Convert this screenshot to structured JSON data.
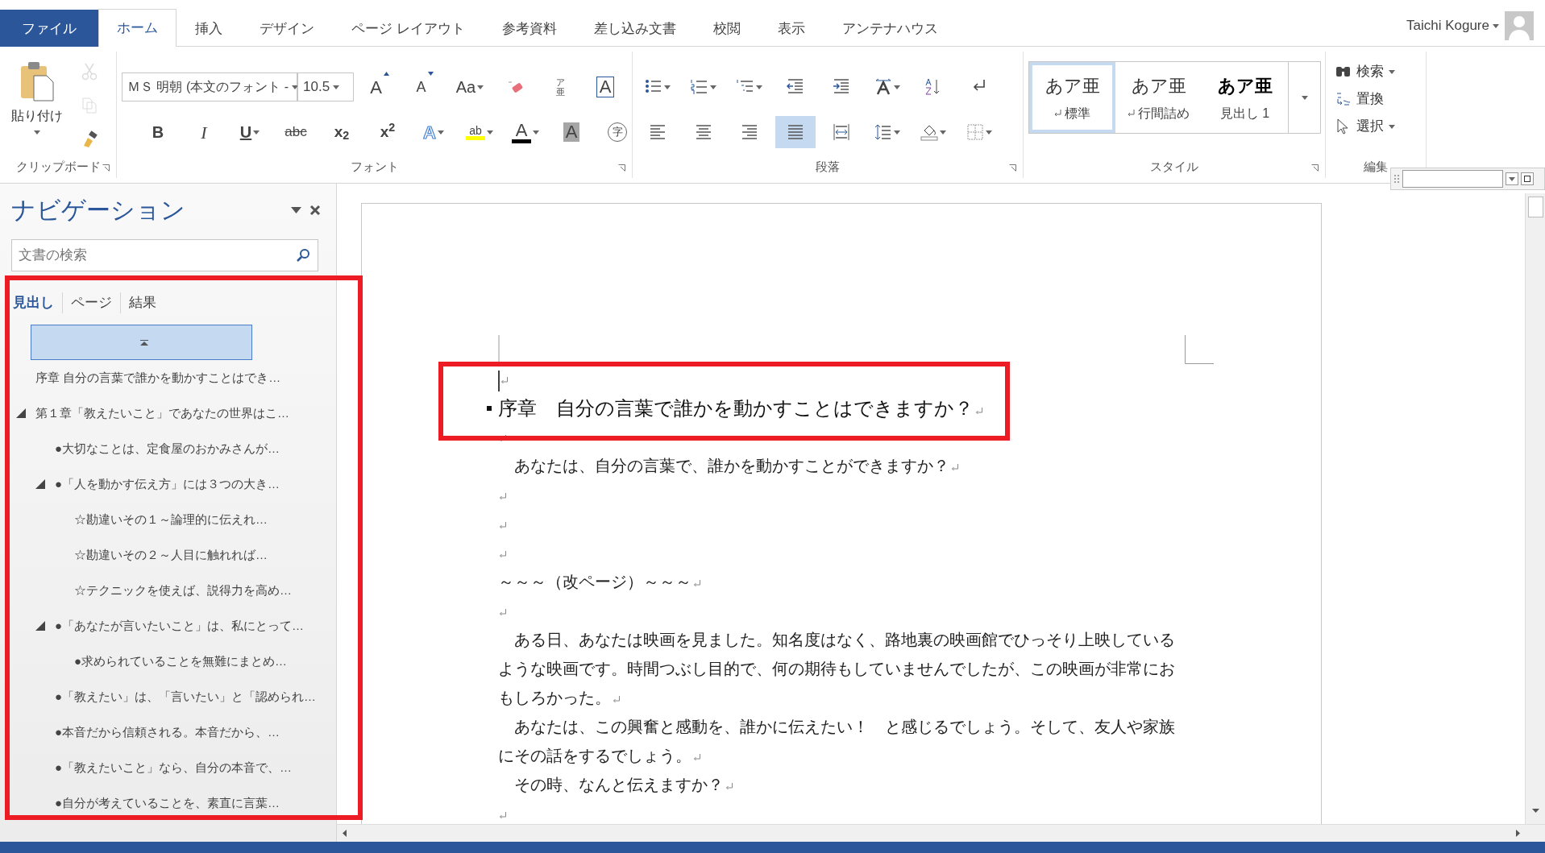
{
  "ribbon_tabs": [
    {
      "label": "ファイル",
      "kind": "file",
      "selected": false
    },
    {
      "label": "ホーム",
      "kind": "tab",
      "selected": true
    },
    {
      "label": "挿入",
      "kind": "tab",
      "selected": false
    },
    {
      "label": "デザイン",
      "kind": "tab",
      "selected": false
    },
    {
      "label": "ページ レイアウト",
      "kind": "tab",
      "selected": false
    },
    {
      "label": "参考資料",
      "kind": "tab",
      "selected": false
    },
    {
      "label": "差し込み文書",
      "kind": "tab",
      "selected": false
    },
    {
      "label": "校閲",
      "kind": "tab",
      "selected": false
    },
    {
      "label": "表示",
      "kind": "tab",
      "selected": false
    },
    {
      "label": "アンテナハウス",
      "kind": "tab",
      "selected": false
    }
  ],
  "user": {
    "name": "Taichi Kogure"
  },
  "clipboard": {
    "paste_label": "貼り付け",
    "group_label": "クリップボード",
    "tools": [
      {
        "kind": "cut",
        "disabled": true
      },
      {
        "kind": "copy",
        "disabled": true
      },
      {
        "kind": "painter",
        "disabled": false
      }
    ]
  },
  "font": {
    "name": "ＭＳ 明朝 (本文のフォント -",
    "size": "10.5",
    "group_label": "フォント",
    "row1": [
      {
        "kind": "grow",
        "label": "A"
      },
      {
        "kind": "shrink",
        "label": "A"
      },
      {
        "kind": "case",
        "label": "Aa"
      },
      {
        "kind": "clear"
      },
      {
        "kind": "phonetic",
        "label": "ア亜"
      },
      {
        "kind": "border",
        "label": "A"
      }
    ],
    "row2": [
      {
        "kind": "bold",
        "label": "B"
      },
      {
        "kind": "italic",
        "label": "I"
      },
      {
        "kind": "underline",
        "label": "U"
      },
      {
        "kind": "strike",
        "label": "abc"
      },
      {
        "kind": "sub",
        "label": "x$_{2}$"
      },
      {
        "kind": "sup",
        "label": "x$^{2}$"
      },
      {
        "kind": "effect",
        "label": "A"
      },
      {
        "kind": "highlight",
        "label": "ab",
        "color": "#ffff00"
      },
      {
        "kind": "fontcolor",
        "label": "A",
        "color": "#000000"
      },
      {
        "kind": "shading",
        "label": "A"
      },
      {
        "kind": "enclose",
        "label": "字"
      }
    ]
  },
  "paragraph": {
    "group_label": "段落",
    "row1": [
      {
        "kind": "bullets"
      },
      {
        "kind": "numbering"
      },
      {
        "kind": "multilevel"
      },
      {
        "kind": "outdent"
      },
      {
        "kind": "indent"
      },
      {
        "kind": "asian"
      },
      {
        "kind": "sort"
      },
      {
        "kind": "marks"
      }
    ],
    "alignment": [
      {
        "kind": "left",
        "selected": false
      },
      {
        "kind": "center",
        "selected": false
      },
      {
        "kind": "right",
        "selected": false
      },
      {
        "kind": "justify",
        "selected": true
      },
      {
        "kind": "distribute",
        "selected": false
      }
    ],
    "row2_tools": [
      {
        "kind": "spacing"
      },
      {
        "kind": "shading"
      },
      {
        "kind": "borders"
      }
    ]
  },
  "styles": {
    "group_label": "スタイル",
    "items": [
      {
        "sample": "あア亜",
        "label": "標準",
        "para_mark": true,
        "selected": true
      },
      {
        "sample": "あア亜",
        "label": "行間詰め",
        "para_mark": true,
        "selected": false
      },
      {
        "sample": "あア亜",
        "label": "見出し 1",
        "para_mark": false,
        "selected": false
      }
    ]
  },
  "editing": {
    "group_label": "編集",
    "items": [
      {
        "kind": "find",
        "label": "検索",
        "dropdown": true
      },
      {
        "kind": "replace",
        "label": "置換",
        "dropdown": false
      },
      {
        "kind": "select",
        "label": "選択",
        "dropdown": true
      }
    ]
  },
  "navigation": {
    "title": "ナビゲーション",
    "placeholder": "文書の検索",
    "tabs": [
      {
        "label": "見出し",
        "selected": true
      },
      {
        "label": "ページ",
        "selected": false
      },
      {
        "label": "結果",
        "selected": false
      }
    ],
    "headings": [
      {
        "kind": "empty",
        "selected": true
      },
      {
        "kind": "heading",
        "text": "序章 自分の言葉で誰かを動かすことはでき…",
        "selected": false
      },
      {
        "kind": "heading",
        "text": "第１章「教えたいこと」であなたの世界はこ…",
        "selected": false,
        "expanded": true,
        "children": [
          {
            "kind": "heading",
            "text": "●大切なことは、定食屋のおかみさんが…",
            "selected": false
          },
          {
            "kind": "heading",
            "text": "●「人を動かす伝え方」には３つの大き…",
            "selected": false,
            "expanded": true,
            "children": [
              {
                "kind": "heading",
                "text": "☆勘違いその１～論理的に伝えれ…",
                "selected": false
              },
              {
                "kind": "heading",
                "text": "☆勘違いその２～人目に触れれば…",
                "selected": false
              },
              {
                "kind": "heading",
                "text": "☆テクニックを使えば、説得力を高め…",
                "selected": false
              }
            ]
          },
          {
            "kind": "heading",
            "text": "●「あなたが言いたいこと」は、私にとって…",
            "selected": false,
            "expanded": true,
            "children": [
              {
                "kind": "heading",
                "text": "●求められていることを無難にまとめ…",
                "selected": false
              }
            ]
          },
          {
            "kind": "heading",
            "text": "●「教えたい」は、「言いたい」と「認められ…",
            "selected": false
          },
          {
            "kind": "heading",
            "text": "●本音だから信頼される。本音だから、…",
            "selected": false
          },
          {
            "kind": "heading",
            "text": "●「教えたいこと」なら、自分の本音で、…",
            "selected": false
          },
          {
            "kind": "heading",
            "text": "●自分が考えていることを、素直に言葉…",
            "selected": false
          }
        ]
      }
    ]
  },
  "document": {
    "paragraphs": [
      {
        "kind": "empty",
        "cursor": true
      },
      {
        "kind": "heading",
        "text": "序章　自分の言葉で誰かを動かすことはできますか？"
      },
      {
        "kind": "empty",
        "cursor": false
      },
      {
        "kind": "body",
        "indent": true,
        "text": "あなたは、自分の言葉で、誰かを動かすことができますか？"
      },
      {
        "kind": "empty",
        "cursor": false
      },
      {
        "kind": "empty",
        "cursor": false
      },
      {
        "kind": "empty",
        "cursor": false
      },
      {
        "kind": "body",
        "indent": false,
        "text": "～～～（改ページ）～～～"
      },
      {
        "kind": "empty",
        "cursor": false
      },
      {
        "kind": "body",
        "indent": true,
        "text": "ある日、あなたは映画を見ました。知名度はなく、路地裏の映画館でひっそり上映しているような映画です。時間つぶし目的で、何の期待もしていませんでしたが、この映画が非常におもしろかった。"
      },
      {
        "kind": "body",
        "indent": true,
        "text": "あなたは、この興奮と感動を、誰かに伝えたい！　と感じるでしょう。そして、友人や家族にその話をするでしょう。"
      },
      {
        "kind": "body",
        "indent": true,
        "text": "その時、なんと伝えますか？"
      },
      {
        "kind": "empty",
        "cursor": false
      }
    ]
  }
}
